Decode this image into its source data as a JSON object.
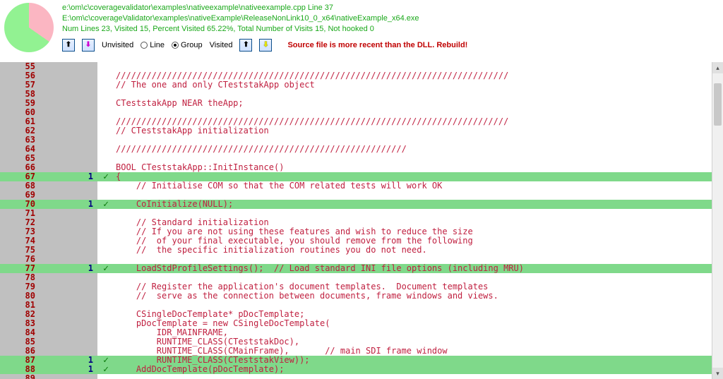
{
  "header": {
    "path_line": "e:\\om\\c\\coveragevalidator\\examples\\nativeexample\\nativeexample.cpp Line 37",
    "exe_line": "E:\\om\\c\\coverageValidator\\examples\\nativeExample\\ReleaseNonLink10_0_x64\\nativeExample_x64.exe",
    "stats_line": "Num Lines    23, Visited    15, Percent Visited 65.22%, Total Number of Visits     15, Not hooked 0"
  },
  "toolbar": {
    "unvisited": "Unvisited",
    "line": "Line",
    "group": "Group",
    "visited": "Visited",
    "warning": "Source file is more recent than the DLL. Rebuild!"
  },
  "chart_data": {
    "type": "pie",
    "title": "",
    "series": [
      {
        "name": "Not Visited",
        "value": 34.78,
        "color": "#fbb6c2"
      },
      {
        "name": "Visited",
        "value": 65.22,
        "color": "#92f292"
      }
    ]
  },
  "code": [
    {
      "n": 55,
      "hits": "",
      "v": false,
      "t": ""
    },
    {
      "n": 56,
      "hits": "",
      "v": false,
      "t": "/////////////////////////////////////////////////////////////////////////////"
    },
    {
      "n": 57,
      "hits": "",
      "v": false,
      "t": "// The one and only CTeststakApp object"
    },
    {
      "n": 58,
      "hits": "",
      "v": false,
      "t": ""
    },
    {
      "n": 59,
      "hits": "",
      "v": false,
      "t": "CTeststakApp NEAR theApp;"
    },
    {
      "n": 60,
      "hits": "",
      "v": false,
      "t": ""
    },
    {
      "n": 61,
      "hits": "",
      "v": false,
      "t": "/////////////////////////////////////////////////////////////////////////////"
    },
    {
      "n": 62,
      "hits": "",
      "v": false,
      "t": "// CTeststakApp initialization"
    },
    {
      "n": 63,
      "hits": "",
      "v": false,
      "t": ""
    },
    {
      "n": 64,
      "hits": "",
      "v": false,
      "t": "/////////////////////////////////////////////////////////"
    },
    {
      "n": 65,
      "hits": "",
      "v": false,
      "t": ""
    },
    {
      "n": 66,
      "hits": "",
      "v": false,
      "t": "BOOL CTeststakApp::InitInstance()"
    },
    {
      "n": 67,
      "hits": "1",
      "v": true,
      "t": "{"
    },
    {
      "n": 68,
      "hits": "",
      "v": false,
      "t": "    // Initialise COM so that the COM related tests will work OK"
    },
    {
      "n": 69,
      "hits": "",
      "v": false,
      "t": ""
    },
    {
      "n": 70,
      "hits": "1",
      "v": true,
      "t": "    CoInitialize(NULL);"
    },
    {
      "n": 71,
      "hits": "",
      "v": false,
      "t": ""
    },
    {
      "n": 72,
      "hits": "",
      "v": false,
      "t": "    // Standard initialization"
    },
    {
      "n": 73,
      "hits": "",
      "v": false,
      "t": "    // If you are not using these features and wish to reduce the size"
    },
    {
      "n": 74,
      "hits": "",
      "v": false,
      "t": "    //  of your final executable, you should remove from the following"
    },
    {
      "n": 75,
      "hits": "",
      "v": false,
      "t": "    //  the specific initialization routines you do not need."
    },
    {
      "n": 76,
      "hits": "",
      "v": false,
      "t": ""
    },
    {
      "n": 77,
      "hits": "1",
      "v": true,
      "t": "    LoadStdProfileSettings();  // Load standard INI file options (including MRU)"
    },
    {
      "n": 78,
      "hits": "",
      "v": false,
      "t": ""
    },
    {
      "n": 79,
      "hits": "",
      "v": false,
      "t": "    // Register the application's document templates.  Document templates"
    },
    {
      "n": 80,
      "hits": "",
      "v": false,
      "t": "    //  serve as the connection between documents, frame windows and views."
    },
    {
      "n": 81,
      "hits": "",
      "v": false,
      "t": ""
    },
    {
      "n": 82,
      "hits": "",
      "v": false,
      "t": "    CSingleDocTemplate* pDocTemplate;"
    },
    {
      "n": 83,
      "hits": "",
      "v": false,
      "t": "    pDocTemplate = new CSingleDocTemplate("
    },
    {
      "n": 84,
      "hits": "",
      "v": false,
      "t": "        IDR_MAINFRAME,"
    },
    {
      "n": 85,
      "hits": "",
      "v": false,
      "t": "        RUNTIME_CLASS(CTeststakDoc),"
    },
    {
      "n": 86,
      "hits": "",
      "v": false,
      "t": "        RUNTIME_CLASS(CMainFrame),       // main SDI frame window"
    },
    {
      "n": 87,
      "hits": "1",
      "v": true,
      "t": "        RUNTIME_CLASS(CTeststakView));"
    },
    {
      "n": 88,
      "hits": "1",
      "v": true,
      "t": "    AddDocTemplate(pDocTemplate);"
    },
    {
      "n": 89,
      "hits": "",
      "v": false,
      "t": ""
    }
  ]
}
